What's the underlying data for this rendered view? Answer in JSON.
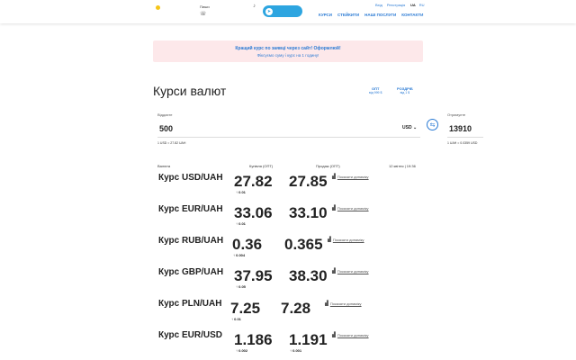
{
  "header": {
    "phone_label": "Пиши",
    "telegram_label": "",
    "auth": [
      "Вхід",
      "Реєстрація"
    ],
    "lang": {
      "active": "UA",
      "other": "RU"
    },
    "nav": [
      "КУРСИ",
      "СТЕЙКИТИ",
      "НАШІ ПОСЛУГИ",
      "КОНТАКТИ"
    ]
  },
  "banner": {
    "line1": "Кращий курс по заявці через сайт! Оформлюй!",
    "line2": "Фіксуємо суму і курс на 1 годину!"
  },
  "page": {
    "title": "Курси валют",
    "opt_label": "ОПТ",
    "opt_sub": "від 999 $",
    "retail_label": "РОЗДРІБ",
    "retail_sub": "від 1 $"
  },
  "converter": {
    "give_label": "Віддаєте",
    "give_amount": "500",
    "give_currency": "USD",
    "give_rate": "1 USD = 27.82 UAH",
    "receive_label": "Отримуєте",
    "receive_amount": "13910",
    "receive_rate": "1 UAH = 0.0359 USD"
  },
  "table": {
    "headers": {
      "currency": "Валюта",
      "buy": "Купівля (ОПТ)",
      "sell": "Продаж (ОПТ)",
      "date": "12 квітня | 19:36"
    },
    "chart_label": "Показати динаміку",
    "rows": [
      {
        "name": "Курс USD/UAH",
        "buy": "27.82",
        "sell": "27.85",
        "buy_delta": "0.01",
        "sell_delta": ""
      },
      {
        "name": "Курс EUR/UAH",
        "buy": "33.06",
        "sell": "33.10",
        "buy_delta": "0.01",
        "sell_delta": ""
      },
      {
        "name": "Курс RUB/UAH",
        "buy": "0.36",
        "sell": "0.365",
        "buy_delta": "0.004",
        "sell_delta": ""
      },
      {
        "name": "Курс GBP/UAH",
        "buy": "37.95",
        "sell": "38.30",
        "buy_delta": "0.05",
        "sell_delta": ""
      },
      {
        "name": "Курс PLN/UAH",
        "buy": "7.25",
        "sell": "7.28",
        "buy_delta": "0.01",
        "sell_delta": ""
      },
      {
        "name": "Курс EUR/USD",
        "buy": "1.186",
        "sell": "1.191",
        "buy_delta": "0.002",
        "sell_delta": "0.001"
      }
    ]
  },
  "colors": {
    "accent": "#2a7ad4",
    "telegram": "#2da5e0",
    "banner_bg": "#fde8ea",
    "logo": "#f5c518"
  }
}
